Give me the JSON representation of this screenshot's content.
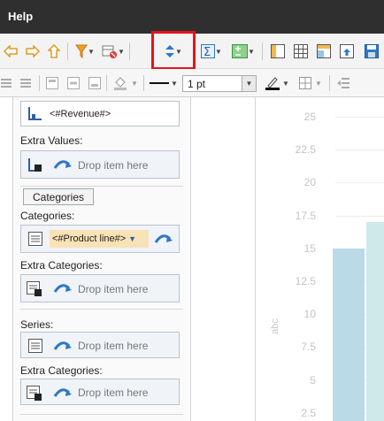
{
  "titlebar": {
    "title": "Help"
  },
  "toolbar2": {
    "line_width": "1 pt"
  },
  "panel": {
    "value_field": "<#Revenue#>",
    "extra_values_label": "Extra Values:",
    "drop_text": "Drop item here",
    "categories_tab": "Categories",
    "categories_label": "Categories:",
    "category_field": "<#Product line#>",
    "extra_categories_label": "Extra Categories:",
    "series_label": "Series:",
    "extra_categories_label_2": "Extra Categories:"
  },
  "chart_data": {
    "type": "bar",
    "yticks": [
      "25",
      "22.5",
      "20",
      "17.5",
      "15",
      "12.5",
      "10",
      "7.5",
      "5",
      "2.5"
    ],
    "ylabel": "abc",
    "series": [
      {
        "values": [
          15
        ],
        "color": "#b9dae6"
      },
      {
        "values": [
          17
        ],
        "color": "#cfe9ea"
      }
    ]
  },
  "colors": {
    "highlight": "#e3141c",
    "accent": "#2f78c4"
  }
}
